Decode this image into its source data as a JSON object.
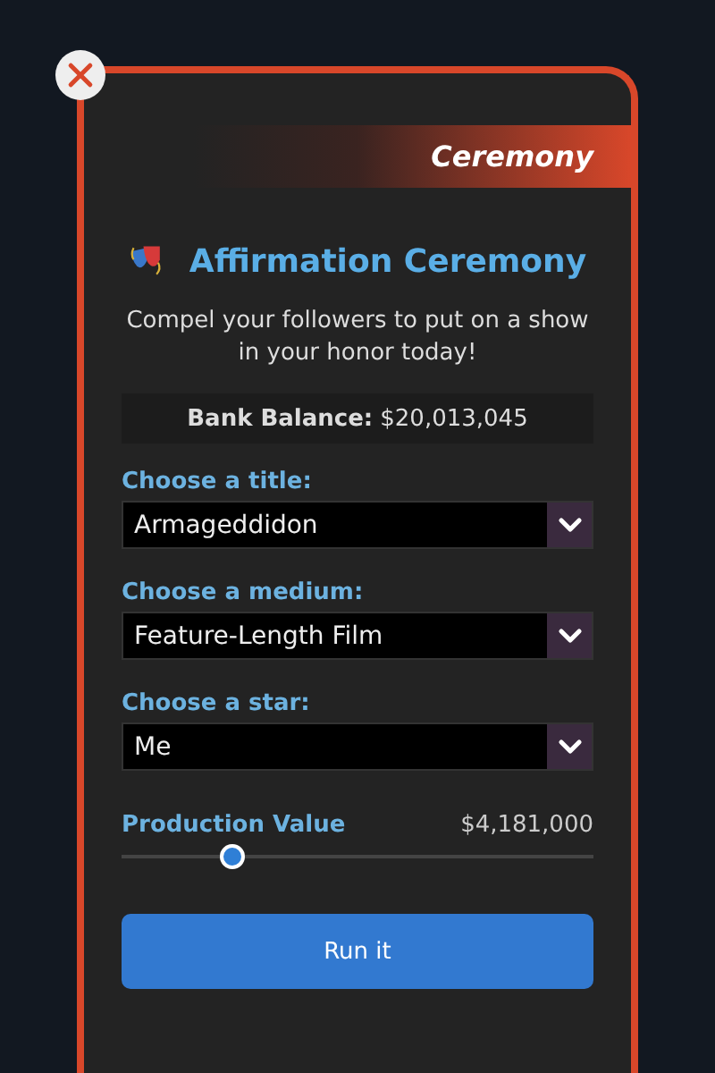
{
  "header": {
    "label": "Ceremony"
  },
  "title": "Affirmation Ceremony",
  "description": "Compel your followers to put on a show in your honor today!",
  "bank_balance": {
    "label": "Bank Balance:",
    "value": "$20,013,045"
  },
  "selects": [
    {
      "label": "Choose a title:",
      "value": "Armageddidon"
    },
    {
      "label": "Choose a medium:",
      "value": "Feature-Length Film"
    },
    {
      "label": "Choose a star:",
      "value": "Me"
    }
  ],
  "slider": {
    "label": "Production Value",
    "reading": "$4,181,000",
    "level": 0.235
  },
  "button": "Run it"
}
